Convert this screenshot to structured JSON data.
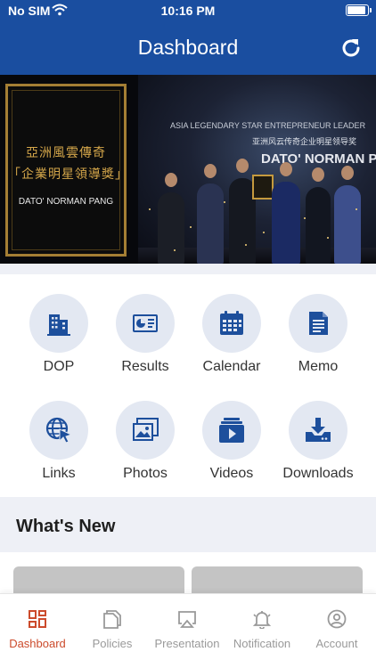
{
  "status_bar": {
    "carrier": "No SIM",
    "time": "10:16 PM"
  },
  "header": {
    "title": "Dashboard"
  },
  "banner": {
    "chinese_line1": "亞洲風雲傳奇",
    "chinese_line2": "「企業明星領導獎」",
    "name": "DATO' NORMAN PANG",
    "photo_headline": "ASIA LEGENDARY STAR ENTREPRENEUR LEADER",
    "photo_subline": "亚洲风云传奇企业明星领导奖",
    "photo_bigtext": "DATO' NORMAN PANG"
  },
  "menu": [
    {
      "label": "DOP",
      "icon": "building-icon"
    },
    {
      "label": "Results",
      "icon": "presentation-chart-icon"
    },
    {
      "label": "Calendar",
      "icon": "calendar-icon"
    },
    {
      "label": "Memo",
      "icon": "document-icon"
    },
    {
      "label": "Links",
      "icon": "globe-cursor-icon"
    },
    {
      "label": "Photos",
      "icon": "photos-icon"
    },
    {
      "label": "Videos",
      "icon": "video-icon"
    },
    {
      "label": "Downloads",
      "icon": "download-tray-icon"
    }
  ],
  "whats_new": {
    "title": "What's New"
  },
  "tabs": [
    {
      "label": "Dashboard",
      "icon": "dashboard-icon",
      "active": true
    },
    {
      "label": "Policies",
      "icon": "policies-icon",
      "active": false
    },
    {
      "label": "Presentation",
      "icon": "airplay-icon",
      "active": false
    },
    {
      "label": "Notification",
      "icon": "bell-icon",
      "active": false
    },
    {
      "label": "Account",
      "icon": "account-icon",
      "active": false
    }
  ],
  "colors": {
    "primary": "#1a4ea0",
    "icon_blue": "#1d4f9c",
    "icon_bg": "#e3e8f2",
    "active_tab": "#cc4b2c",
    "inactive_tab": "#9a9a9a"
  }
}
